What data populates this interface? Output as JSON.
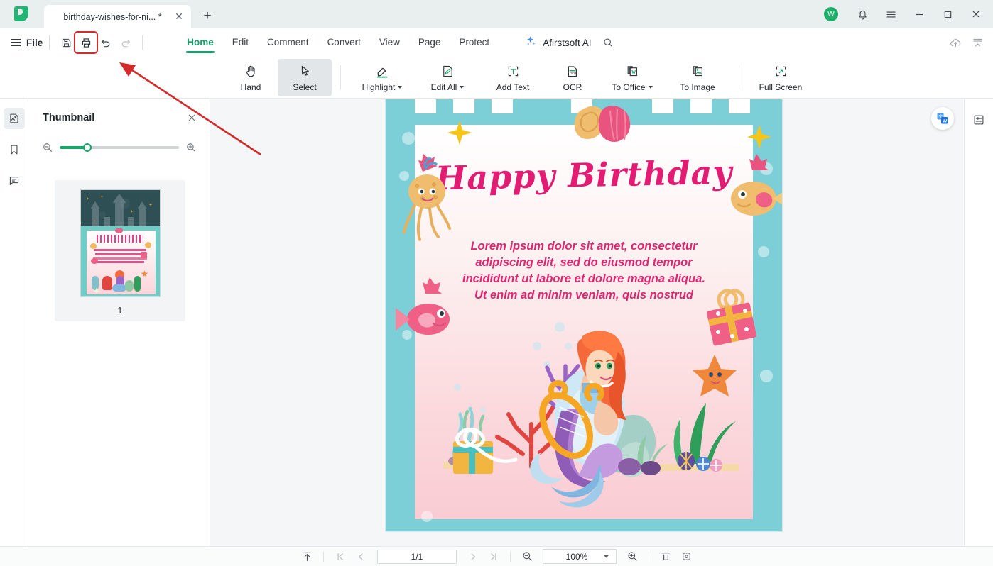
{
  "window": {
    "tab_title": "birthday-wishes-for-ni... *",
    "new_tab_label": "+",
    "close_tab_label": "✕",
    "avatar_initial": "W",
    "minimize_label": "—",
    "maximize_label": "▢",
    "close_label": "✕",
    "accent_green": "#18a06a",
    "titlebar_bg": "#e9eeee"
  },
  "menubar": {
    "file_label": "File",
    "quick_actions": [
      {
        "name": "save-as",
        "state": "enabled"
      },
      {
        "name": "print",
        "state": "highlighted"
      },
      {
        "name": "undo",
        "state": "enabled"
      },
      {
        "name": "redo",
        "state": "disabled"
      }
    ],
    "tabs": [
      {
        "label": "Home",
        "active": true
      },
      {
        "label": "Edit",
        "active": false
      },
      {
        "label": "Comment",
        "active": false
      },
      {
        "label": "Convert",
        "active": false
      },
      {
        "label": "View",
        "active": false
      },
      {
        "label": "Page",
        "active": false
      },
      {
        "label": "Protect",
        "active": false
      }
    ],
    "ai_label": "Afirstsoft AI"
  },
  "ribbon": {
    "tools": [
      {
        "label": "Hand",
        "icon": "hand-icon",
        "selected": false,
        "dropdown": false
      },
      {
        "label": "Select",
        "icon": "cursor-icon",
        "selected": true,
        "dropdown": false
      },
      {
        "label": "Highlight",
        "icon": "highlighter-icon",
        "selected": false,
        "dropdown": true
      },
      {
        "label": "Edit All",
        "icon": "edit-document-icon",
        "selected": false,
        "dropdown": true
      },
      {
        "label": "Add Text",
        "icon": "add-text-icon",
        "selected": false,
        "dropdown": false
      },
      {
        "label": "OCR",
        "icon": "ocr-icon",
        "selected": false,
        "dropdown": false
      },
      {
        "label": "To Office",
        "icon": "to-office-icon",
        "selected": false,
        "dropdown": true
      },
      {
        "label": "To Image",
        "icon": "to-image-icon",
        "selected": false,
        "dropdown": false
      },
      {
        "label": "Full Screen",
        "icon": "fullscreen-icon",
        "selected": false,
        "dropdown": false
      }
    ]
  },
  "left_rail": {
    "items": [
      {
        "name": "thumbnail-panel",
        "icon": "thumbnail-icon",
        "active": true
      },
      {
        "name": "bookmark-panel",
        "icon": "bookmark-icon",
        "active": false
      },
      {
        "name": "comment-panel",
        "icon": "comment-icon",
        "active": false
      }
    ]
  },
  "thumbnail_panel": {
    "title": "Thumbnail",
    "close_label": "✕",
    "zoom_out_icon": "zoom-out-icon",
    "zoom_in_icon": "zoom-in-icon",
    "zoom_slider_percent": 23,
    "pages": [
      {
        "number": "1",
        "selected": true
      }
    ]
  },
  "document": {
    "title_text": "Happy Birthday",
    "body_text": "Lorem ipsum dolor sit amet, consectetur adipiscing elit, sed do eiusmod tempor incididunt ut labore et dolore magna aliqua. Ut enim ad minim veniam, quis nostrud",
    "body_lines": [
      "Lorem ipsum dolor sit amet, consectetur",
      "adipiscing elit, sed do eiusmod tempor",
      "incididunt ut labore et dolore magna aliqua.",
      "Ut enim ad minim veniam, quis nostrud"
    ],
    "theme_colors": {
      "border_teal": "#7ccfd7",
      "title_pink": "#e31b72",
      "body_pink": "#e0246f"
    }
  },
  "right_rail": {
    "items": [
      {
        "name": "properties-panel",
        "icon": "sliders-icon"
      }
    ],
    "translate_fab_icon": "translate-word-icon"
  },
  "statusbar": {
    "first_page_icon": "go-to-top-icon",
    "jump_first_icon": "first-page-icon",
    "prev_icon": "previous-page-icon",
    "page_value": "1/1",
    "next_icon": "next-page-icon",
    "jump_last_icon": "last-page-icon",
    "zoom_out_icon": "zoom-out-icon",
    "zoom_value": "100%",
    "zoom_in_icon": "zoom-in-icon",
    "fit_width_icon": "fit-width-icon",
    "fit_page_icon": "fit-page-icon"
  },
  "annotation": {
    "arrow_color": "#d42a2a",
    "highlight_box_color": "#d42a2a",
    "target": "print-button"
  }
}
